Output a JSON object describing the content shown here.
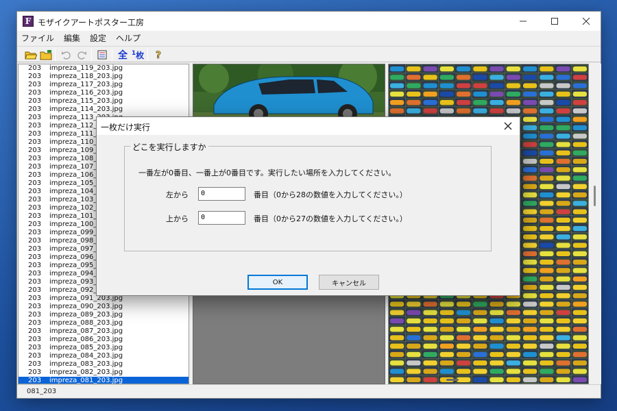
{
  "window": {
    "title": "モザイクアートポスター工房",
    "app_icon_letter": "F",
    "controls": [
      "minimize",
      "maximize",
      "close"
    ]
  },
  "menu": [
    "ファイル",
    "編集",
    "設定",
    "ヘルプ"
  ],
  "toolbar": {
    "all_label": "全",
    "one_label_num": "1",
    "one_label": "枚",
    "icons": [
      "open-folder-icon",
      "new-folder-icon",
      "undo-icon",
      "redo-icon",
      "list-icon",
      "all-icon",
      "one-sheet-icon",
      "help-icon"
    ]
  },
  "file_list": {
    "rows": [
      {
        "num": "203",
        "name": "impreza_119_203.jpg"
      },
      {
        "num": "203",
        "name": "impreza_118_203.jpg"
      },
      {
        "num": "203",
        "name": "impreza_117_203.jpg"
      },
      {
        "num": "203",
        "name": "impreza_116_203.jpg"
      },
      {
        "num": "203",
        "name": "impreza_115_203.jpg"
      },
      {
        "num": "203",
        "name": "impreza_114_203.jpg"
      },
      {
        "num": "203",
        "name": "impreza_113_203.jpg"
      },
      {
        "num": "203",
        "name": "impreza_112_2"
      },
      {
        "num": "203",
        "name": "impreza_111_2"
      },
      {
        "num": "203",
        "name": "impreza_110_2"
      },
      {
        "num": "203",
        "name": "impreza_109_2"
      },
      {
        "num": "203",
        "name": "impreza_108_2"
      },
      {
        "num": "203",
        "name": "impreza_107_2"
      },
      {
        "num": "203",
        "name": "impreza_106_2"
      },
      {
        "num": "203",
        "name": "impreza_105_2"
      },
      {
        "num": "203",
        "name": "impreza_104_2"
      },
      {
        "num": "203",
        "name": "impreza_103_2"
      },
      {
        "num": "203",
        "name": "impreza_102_2"
      },
      {
        "num": "203",
        "name": "impreza_101_2"
      },
      {
        "num": "203",
        "name": "impreza_100_2"
      },
      {
        "num": "203",
        "name": "impreza_099_2"
      },
      {
        "num": "203",
        "name": "impreza_098_2"
      },
      {
        "num": "203",
        "name": "impreza_097_2"
      },
      {
        "num": "203",
        "name": "impreza_096_2"
      },
      {
        "num": "203",
        "name": "impreza_095_2"
      },
      {
        "num": "203",
        "name": "impreza_094_2"
      },
      {
        "num": "203",
        "name": "impreza_093_2"
      },
      {
        "num": "203",
        "name": "impreza_092_2"
      },
      {
        "num": "203",
        "name": "impreza_091_203.jpg"
      },
      {
        "num": "203",
        "name": "impreza_090_203.jpg"
      },
      {
        "num": "203",
        "name": "impreza_089_203.jpg"
      },
      {
        "num": "203",
        "name": "impreza_088_203.jpg"
      },
      {
        "num": "203",
        "name": "impreza_087_203.jpg"
      },
      {
        "num": "203",
        "name": "impreza_086_203.jpg"
      },
      {
        "num": "203",
        "name": "impreza_085_203.jpg"
      },
      {
        "num": "203",
        "name": "impreza_084_203.jpg"
      },
      {
        "num": "203",
        "name": "impreza_083_203.jpg"
      },
      {
        "num": "203",
        "name": "impreza_082_203.jpg"
      },
      {
        "num": "203",
        "name": "impreza_081_203.jpg",
        "selected": true
      }
    ]
  },
  "status": "081_203",
  "dialog": {
    "title": "一枚だけ実行",
    "group_label": "どこを実行しますか",
    "instruction": "一番左が0番目、一番上が0番目です。実行したい場所を入力してください。",
    "left_label": "左から",
    "left_value": "0",
    "left_hint": "番目（0から28の数値を入力してください。）",
    "top_label": "上から",
    "top_value": "0",
    "top_hint": "番目（0から27の数値を入力してください。）",
    "ok_label": "OK",
    "cancel_label": "キャンセル"
  },
  "colors": {
    "accent": "#0a64d8",
    "car_blue": "#1f8fd0",
    "mosaic_yellow": "#e8c21a"
  }
}
